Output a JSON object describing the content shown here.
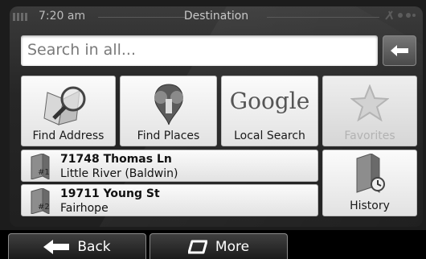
{
  "status": {
    "time": "7:20 am",
    "title": "Destination"
  },
  "search": {
    "placeholder": "Search in all...",
    "backspace_icon": "backspace-arrow-icon"
  },
  "tiles": [
    {
      "label": "Find Address",
      "icon": "map-magnifier-icon",
      "enabled": true
    },
    {
      "label": "Find Places",
      "icon": "places-pin-icon",
      "enabled": true
    },
    {
      "label": "Local Search",
      "icon": "google-logo-icon",
      "logo_text": "Google",
      "enabled": true
    },
    {
      "label": "Favorites",
      "icon": "star-icon",
      "enabled": false
    }
  ],
  "history_items": [
    {
      "street": "71748 Thomas Ln",
      "city": "Little River (Baldwin)",
      "badge": "#1"
    },
    {
      "street": "19711 Young St",
      "city": "Fairhope",
      "badge": "#2"
    }
  ],
  "history_button": {
    "label": "History",
    "icon": "history-folder-icon"
  },
  "bottom_bar": {
    "back_label": "Back",
    "more_label": "More"
  }
}
